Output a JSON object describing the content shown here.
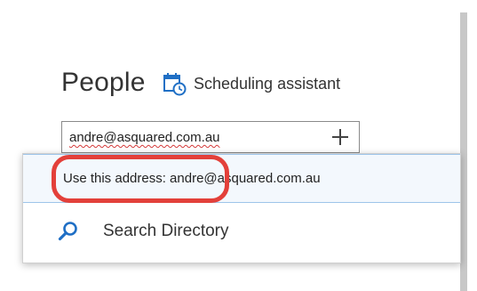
{
  "people_panel": {
    "title": "People",
    "scheduling_assistant_label": "Scheduling assistant",
    "attendee_input_value": "andre@asquared.com.au"
  },
  "suggestions": {
    "use_address_label": "Use this address: andre@asquared.com.au",
    "search_directory_label": "Search Directory"
  },
  "icons": {
    "scheduling": "calendar-clock-icon",
    "add": "plus-icon",
    "search": "search-icon"
  },
  "colors": {
    "accent_blue": "#1f6fc5",
    "highlight_red": "#e3403a",
    "hover_row": "#f3f8fd"
  }
}
